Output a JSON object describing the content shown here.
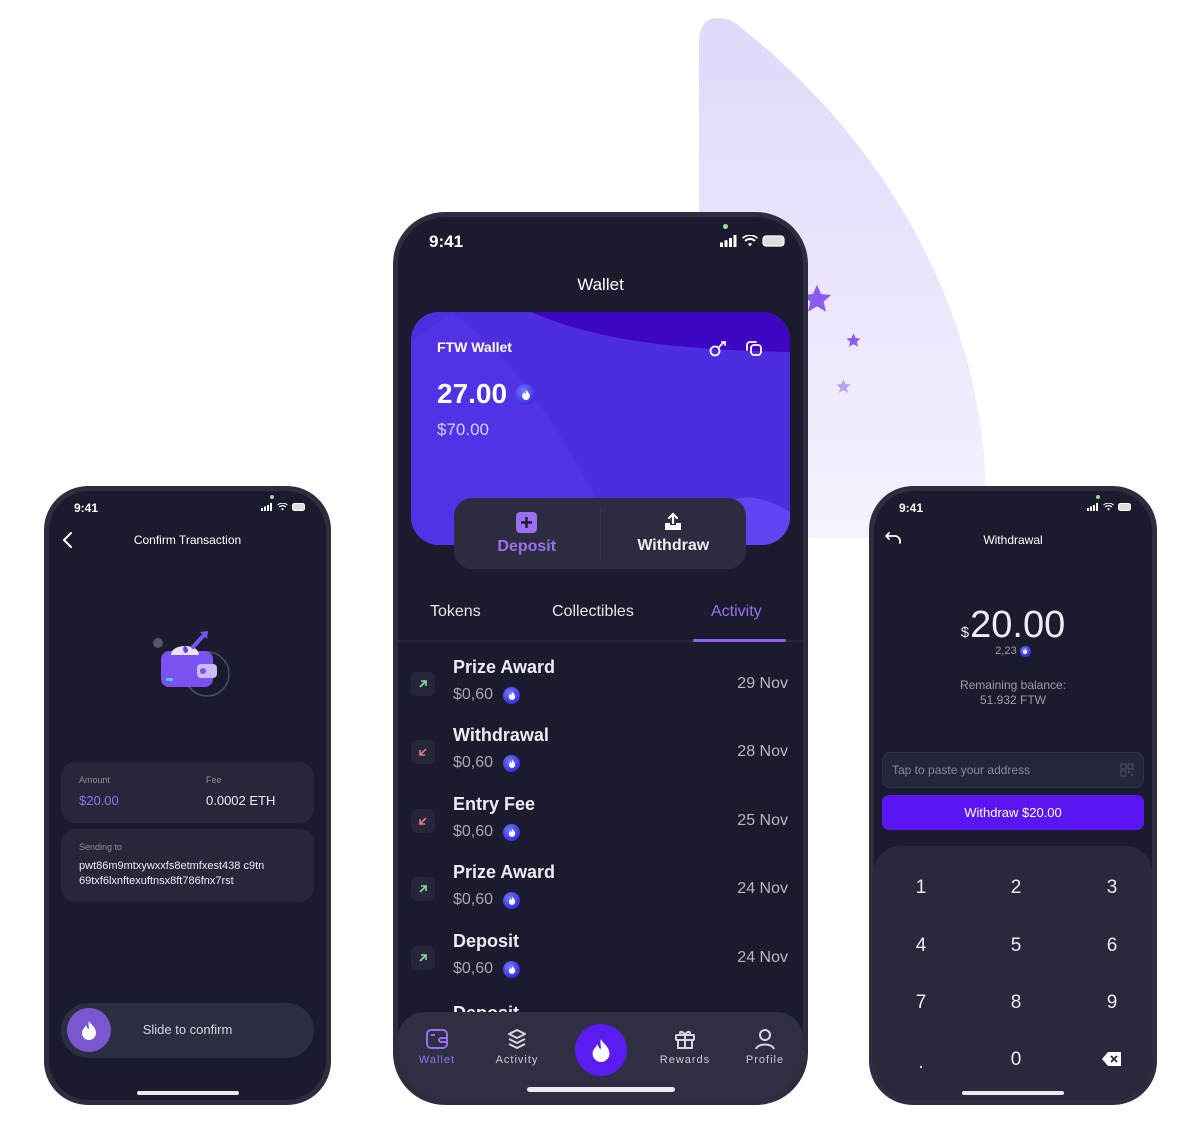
{
  "theme": {
    "accent": "#9a6ff0",
    "primary_button": "#5a16f2",
    "screen_bg": "#1a1c2e",
    "card_gradient": [
      "#3f00c8",
      "#5a3cf0"
    ],
    "positive_arrow": "#8fd6a0",
    "negative_arrow": "#e07a7a"
  },
  "confirm_screen": {
    "status_time": "9:41",
    "title": "Confirm Transaction",
    "back_icon": "chevron-left-icon",
    "illustration": "wallet-send-illustration",
    "amount_label": "Amount",
    "amount_value": "$20.00",
    "fee_label": "Fee",
    "fee_value": "0.0002 ETH",
    "sending_to_label": "Sending to",
    "address_line1": "pwt86m9mtxywxxfs8etmfxest438 c9tn",
    "address_line2": "69txf6lxnftexuftnsx8ft786fnx7rst",
    "slide_label": "Slide to confirm",
    "slide_icon": "flame-icon"
  },
  "wallet_screen": {
    "status_time": "9:41",
    "title": "Wallet",
    "card": {
      "name": "FTW Wallet",
      "token_amount": "27.00",
      "usd_amount": "$70.00",
      "icons": [
        "key-icon",
        "copy-icon"
      ]
    },
    "actions": [
      {
        "label": "Deposit",
        "icon": "plus-square-icon",
        "active": true
      },
      {
        "label": "Withdraw",
        "icon": "upload-tray-icon",
        "active": false
      }
    ],
    "tabs": [
      {
        "label": "Tokens",
        "active": false
      },
      {
        "label": "Collectibles",
        "active": false
      },
      {
        "label": "Activity",
        "active": true
      }
    ],
    "activity": [
      {
        "title": "Prize Award",
        "amount": "$0,60",
        "date": "29 Nov",
        "direction": "in"
      },
      {
        "title": "Withdrawal",
        "amount": "$0,60",
        "date": "28 Nov",
        "direction": "out"
      },
      {
        "title": "Entry Fee",
        "amount": "$0,60",
        "date": "25 Nov",
        "direction": "out"
      },
      {
        "title": "Prize Award",
        "amount": "$0,60",
        "date": "24 Nov",
        "direction": "in"
      },
      {
        "title": "Deposit",
        "amount": "$0,60",
        "date": "24 Nov",
        "direction": "in"
      }
    ],
    "partial_row_title": "Deposit",
    "bottom_nav": [
      {
        "label": "Wallet",
        "icon": "wallet-icon",
        "active": true
      },
      {
        "label": "Activity",
        "icon": "layers-icon",
        "active": false
      },
      {
        "label": "",
        "icon": "flame-icon",
        "active": false
      },
      {
        "label": "Rewards",
        "icon": "gift-icon",
        "active": false
      },
      {
        "label": "Profile",
        "icon": "user-icon",
        "active": false
      }
    ]
  },
  "withdraw_screen": {
    "status_time": "9:41",
    "title": "Withdrawal",
    "back_icon": "undo-arrow-icon",
    "currency_symbol": "$",
    "amount": "20.00",
    "token_amount": "2,23",
    "remaining_label": "Remaining balance:",
    "remaining_value": "51.932 FTW",
    "address_placeholder": "Tap to paste your address",
    "address_value": "",
    "scan_icon": "qr-code-icon",
    "withdraw_button": "Withdraw $20.00",
    "keypad": [
      "1",
      "2",
      "3",
      "4",
      "5",
      "6",
      "7",
      "8",
      "9",
      ".",
      "0",
      "backspace"
    ]
  }
}
